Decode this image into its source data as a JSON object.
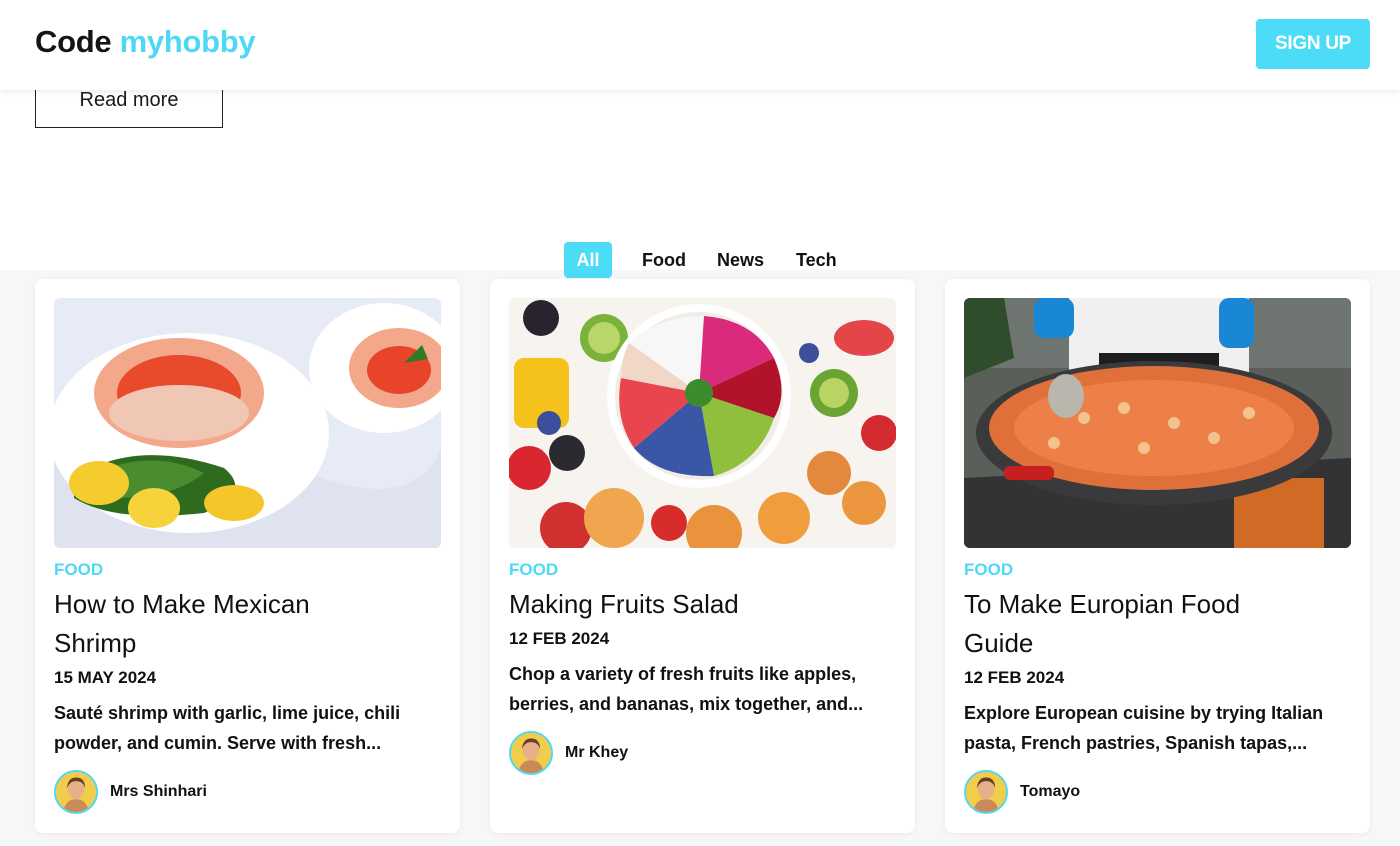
{
  "header": {
    "logo_part1": "Code",
    "logo_part2": "myhobby",
    "signup_label": "SIGN UP"
  },
  "hero": {
    "read_more_label": "Read more"
  },
  "filters": [
    "All",
    "Food",
    "News",
    "Tech"
  ],
  "active_filter": "All",
  "colors": {
    "accent": "#4ddcf8",
    "text": "#111111",
    "background": "#f6f7f9"
  },
  "posts": [
    {
      "category": "FOOD",
      "title_line1": "How to Make Mexican",
      "title_line2": "Shrimp",
      "date": "15 MAY 2024",
      "excerpt_line1": "Sauté shrimp with garlic, lime juice, chili",
      "excerpt_line2": "powder, and cumin. Serve with fresh...",
      "author": "Mrs Shinhari",
      "image_icon": "shrimp-cocktail-photo"
    },
    {
      "category": "FOOD",
      "title_line1": "Making Fruits Salad",
      "title_line2": "",
      "date": "12 FEB 2024",
      "excerpt_line1": "Chop a variety of fresh fruits like apples,",
      "excerpt_line2": "berries, and bananas, mix together, and...",
      "author": "Mr Khey",
      "image_icon": "fruit-bowl-photo"
    },
    {
      "category": "FOOD",
      "title_line1": "To Make Europian Food",
      "title_line2": "Guide",
      "date": "12 FEB 2024",
      "excerpt_line1": "Explore European cuisine by trying Italian",
      "excerpt_line2": "pasta, French pastries, Spanish tapas,...",
      "author": "Tomayo",
      "image_icon": "paella-pan-photo"
    }
  ]
}
